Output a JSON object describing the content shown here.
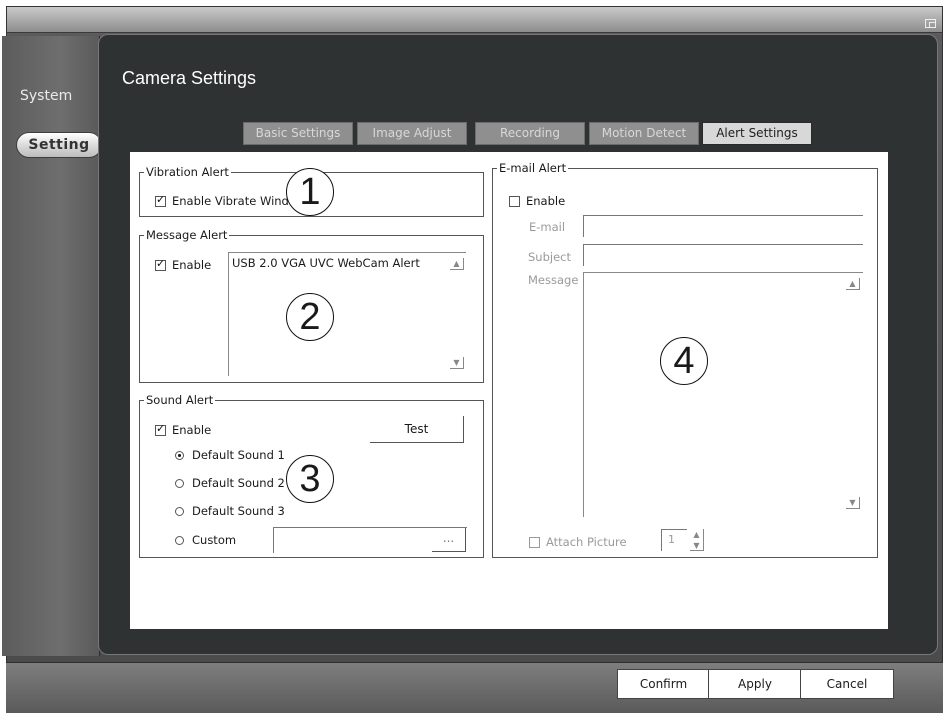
{
  "sidebar": {
    "system_label": "System",
    "setting_label": "Setting"
  },
  "page": {
    "title": "Camera Settings"
  },
  "tabs": [
    {
      "label": "Basic Settings"
    },
    {
      "label": "Image Adjust"
    },
    {
      "label": "Recording"
    },
    {
      "label": "Motion Detect"
    },
    {
      "label": "Alert Settings"
    }
  ],
  "vibration_alert": {
    "legend": "Vibration Alert",
    "enable_label": "Enable Vibrate Wind",
    "checked": true
  },
  "message_alert": {
    "legend": "Message Alert",
    "enable_label": "Enable",
    "checked": true,
    "message_text": "USB 2.0 VGA UVC WebCam Alert"
  },
  "sound_alert": {
    "legend": "Sound Alert",
    "enable_label": "Enable",
    "checked": true,
    "test_button": "Test",
    "options": [
      "Default Sound 1",
      "Default Sound 2",
      "Default Sound 3",
      "Custom"
    ],
    "selected": "Default Sound 1",
    "browse_button": "..."
  },
  "email_alert": {
    "legend": "E-mail Alert",
    "enable_label": "Enable",
    "checked": false,
    "email_label": "E-mail",
    "subject_label": "Subject",
    "message_label": "Message",
    "attach_label": "Attach Picture",
    "attach_checked": false,
    "attach_count": "1"
  },
  "callouts": [
    "1",
    "2",
    "3",
    "4"
  ],
  "footer": {
    "confirm": "Confirm",
    "apply": "Apply",
    "cancel": "Cancel"
  }
}
